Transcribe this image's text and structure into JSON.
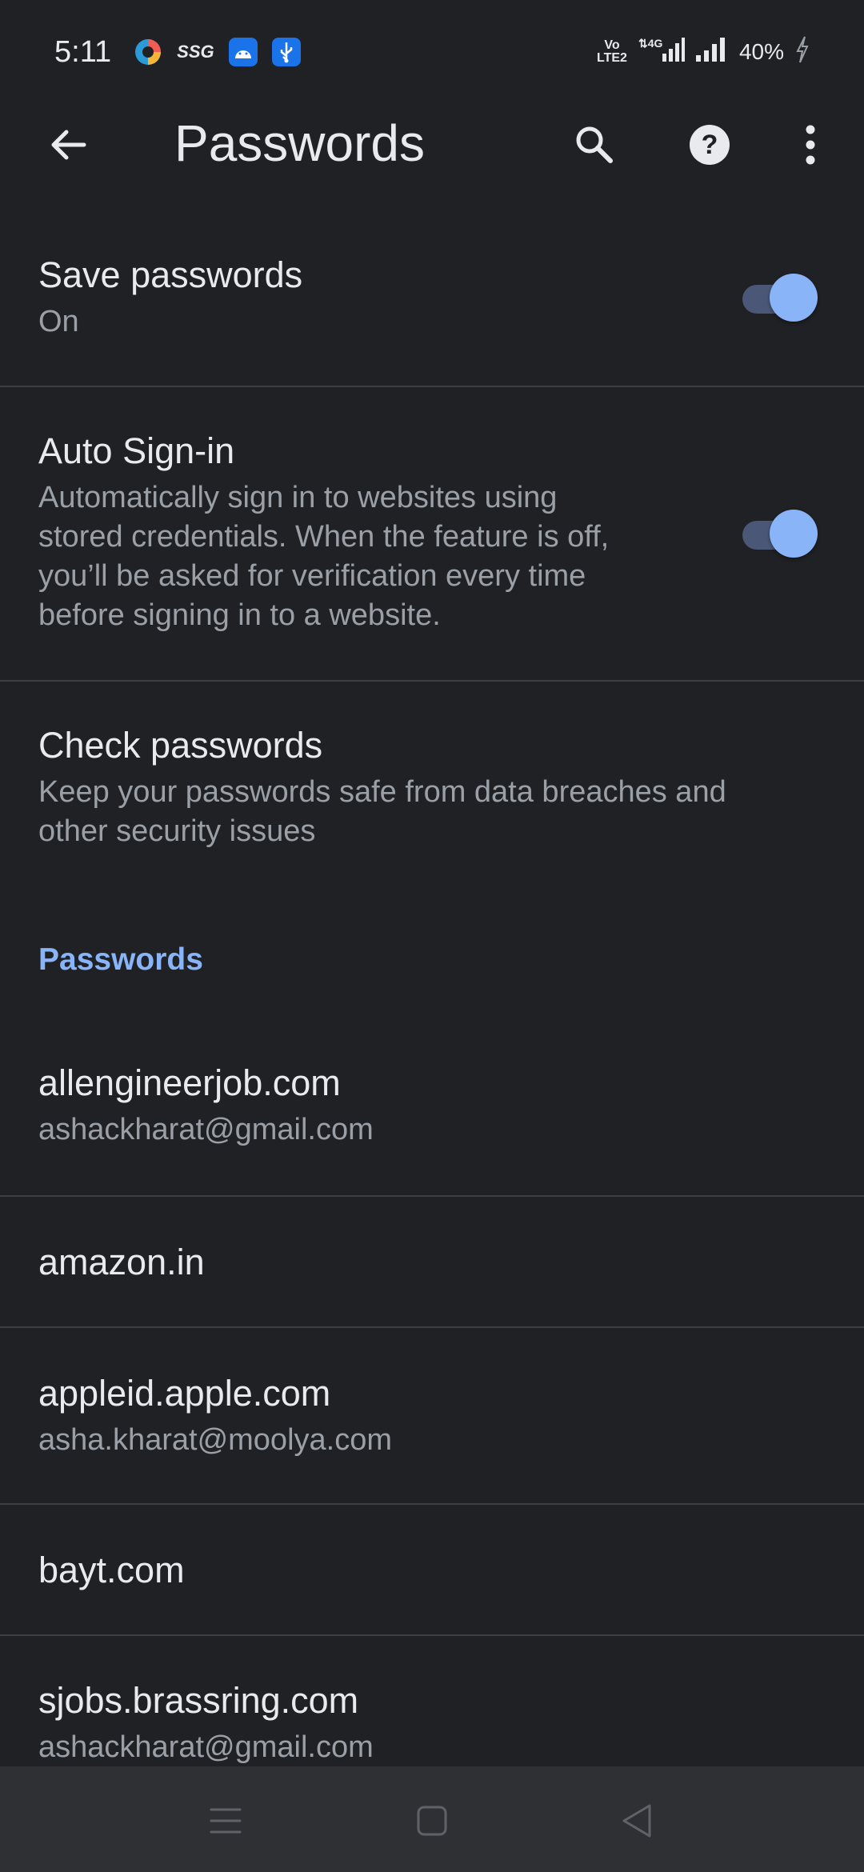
{
  "status_bar": {
    "time": "5:11",
    "app_icons": [
      "edge-browser-icon",
      "ssg-icon",
      "android-debug-icon",
      "usb-icon"
    ],
    "ssg_label": "SSG",
    "network_labels": [
      "VoLTE2",
      "4G"
    ],
    "battery": "40%"
  },
  "app_bar": {
    "title": "Passwords",
    "icons": [
      "back-arrow-icon",
      "search-icon",
      "help-icon",
      "more-vert-icon"
    ]
  },
  "settings": {
    "save_passwords": {
      "title": "Save passwords",
      "subtitle": "On",
      "enabled": true
    },
    "auto_signin": {
      "title": "Auto Sign-in",
      "subtitle_lines": [
        "Automatically sign in to websites using",
        "stored credentials. When the feature is off,",
        "you’ll be asked for verification every time",
        "before signing in to a website."
      ],
      "enabled": true
    },
    "check_passwords": {
      "title": "Check passwords",
      "subtitle_lines": [
        "Keep your passwords safe from data breaches and",
        "other security issues"
      ]
    }
  },
  "passwords_section": {
    "header": "Passwords",
    "entries": [
      {
        "site": "allengineerjob.com",
        "username": "ashackharat@gmail.com"
      },
      {
        "site": "amazon.in",
        "username": ""
      },
      {
        "site": "appleid.apple.com",
        "username": "asha.kharat@moolya.com"
      },
      {
        "site": "bayt.com",
        "username": ""
      },
      {
        "site": "sjobs.brassring.com",
        "username": "ashackharat@gmail.com"
      }
    ]
  },
  "nav_bar": {
    "icons": [
      "menu-icon",
      "home-square-icon",
      "back-triangle-icon"
    ]
  },
  "colors": {
    "background": "#202124",
    "accent": "#8ab4f8",
    "secondary_text": "#9aa0a6",
    "divider": "#3c4043",
    "nav_bar": "#2f3033"
  }
}
